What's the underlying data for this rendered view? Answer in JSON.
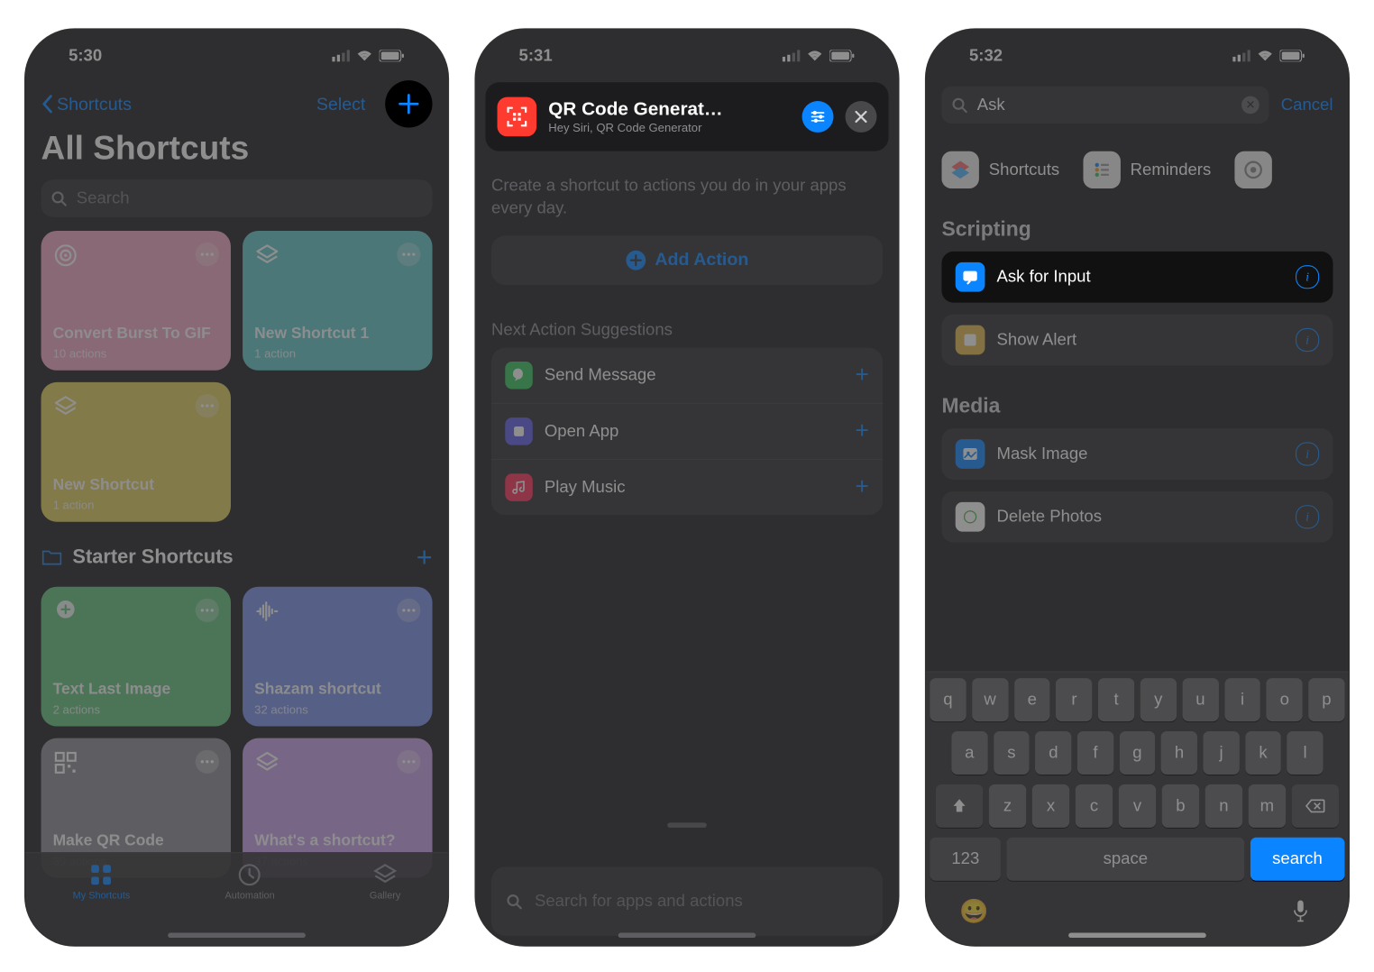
{
  "panel1": {
    "time": "5:30",
    "back": "Shortcuts",
    "select": "Select",
    "title": "All Shortcuts",
    "search_placeholder": "Search",
    "tiles": [
      {
        "title": "Convert Burst To GIF",
        "sub": "10 actions",
        "bg": "#f4a6c0"
      },
      {
        "title": "New Shortcut 1",
        "sub": "1 action",
        "bg": "#63c8c8"
      },
      {
        "title": "New Shortcut",
        "sub": "1 action",
        "bg": "#e5cf5a"
      }
    ],
    "section": "Starter Shortcuts",
    "starter_tiles": [
      {
        "title": "Text Last Image",
        "sub": "2 actions",
        "bg": "#62c47a"
      },
      {
        "title": "Shazam shortcut",
        "sub": "32 actions",
        "bg": "#7a8fe8"
      },
      {
        "title": "Make QR Code",
        "sub": "39 actions",
        "bg": "#8e8e93"
      },
      {
        "title": "What's a shortcut?",
        "sub": "37 actions",
        "bg": "#c9a0e8"
      }
    ],
    "tabs": {
      "my": "My Shortcuts",
      "auto": "Automation",
      "gallery": "Gallery"
    }
  },
  "panel2": {
    "time": "5:31",
    "title": "QR Code Generat…",
    "subtitle": "Hey Siri, QR Code Generator",
    "hint": "Create a shortcut to actions you do in your apps every day.",
    "add_action": "Add Action",
    "next_suggestions": "Next Action Suggestions",
    "suggestions": [
      {
        "label": "Send Message",
        "bg": "#34c759"
      },
      {
        "label": "Open App",
        "bg": "#5e5ce6"
      },
      {
        "label": "Play Music",
        "bg": "#ff2d55"
      }
    ],
    "sheet_placeholder": "Search for apps and actions"
  },
  "panel3": {
    "time": "5:32",
    "search_value": "Ask",
    "cancel": "Cancel",
    "categories": [
      {
        "label": "Shortcuts"
      },
      {
        "label": "Reminders"
      }
    ],
    "sections": [
      {
        "title": "Scripting",
        "items": [
          {
            "label": "Ask for Input",
            "bg": "#0a84ff",
            "highlight": true
          },
          {
            "label": "Show Alert",
            "bg": "#e5b94a"
          }
        ]
      },
      {
        "title": "Media",
        "items": [
          {
            "label": "Mask Image",
            "bg": "#0a84ff"
          },
          {
            "label": "Delete Photos",
            "bg": "#ffffff"
          }
        ]
      }
    ],
    "keys": {
      "r1": [
        "q",
        "w",
        "e",
        "r",
        "t",
        "y",
        "u",
        "i",
        "o",
        "p"
      ],
      "r2": [
        "a",
        "s",
        "d",
        "f",
        "g",
        "h",
        "j",
        "k",
        "l"
      ],
      "r3": [
        "z",
        "x",
        "c",
        "v",
        "b",
        "n",
        "m"
      ],
      "n123": "123",
      "space": "space",
      "search": "search"
    }
  }
}
